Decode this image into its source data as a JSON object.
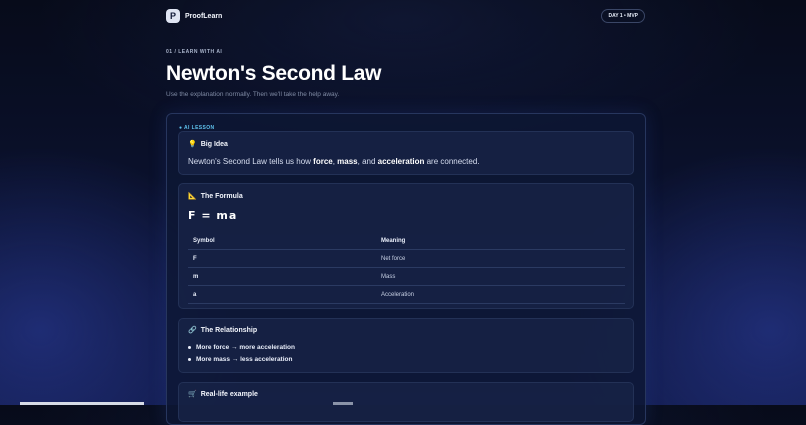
{
  "header": {
    "logo_letter": "P",
    "brand_name": "ProofLearn",
    "badge": "DAY 1 • MVP"
  },
  "page": {
    "eyebrow": "01 / LEARN WITH AI",
    "title": "Newton's Second Law",
    "subtitle": "Use the explanation normally. Then we'll take the help away."
  },
  "lesson": {
    "tag": "● AI LESSON",
    "big_idea": {
      "icon": "lightbulb-icon",
      "title": "Big Idea",
      "text_parts": [
        "Newton's Second Law tells us how ",
        "force",
        ", ",
        "mass",
        ", and ",
        "acceleration",
        " are connected."
      ]
    },
    "formula": {
      "icon": "triangle-ruler-icon",
      "title": "The Formula",
      "expression": "F = ma",
      "columns": [
        "Symbol",
        "Meaning"
      ],
      "rows": [
        {
          "symbol": "F",
          "meaning": "Net force"
        },
        {
          "symbol": "m",
          "meaning": "Mass"
        },
        {
          "symbol": "a",
          "meaning": "Acceleration"
        }
      ]
    },
    "relationship": {
      "icon": "link-icon",
      "title": "The Relationship",
      "items": [
        "More force → more acceleration",
        "More mass → less acceleration"
      ]
    },
    "real_life": {
      "icon": "shopping-cart-icon",
      "title": "Real-life example"
    }
  }
}
